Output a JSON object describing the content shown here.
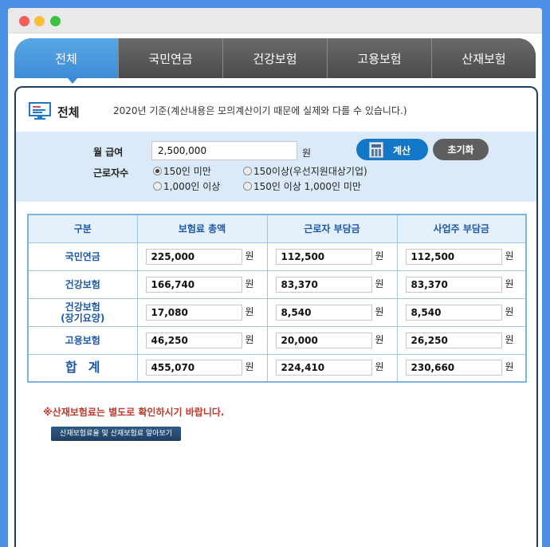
{
  "tabs": [
    {
      "label": "전체",
      "active": true
    },
    {
      "label": "국민연금",
      "active": false
    },
    {
      "label": "건강보험",
      "active": false
    },
    {
      "label": "고용보험",
      "active": false
    },
    {
      "label": "산재보험",
      "active": false
    }
  ],
  "header": {
    "title": "전체",
    "note": "2020년 기준(계산내용은 모의계산이기 때문에 실제와 다를 수 있습니다.)",
    "icon": "monitor-icon"
  },
  "form": {
    "salary_label": "월 급여",
    "salary_value": "2,500,000",
    "salary_unit": "원",
    "workers_label": "근로자수",
    "options": [
      {
        "label": "150인 미만",
        "selected": true
      },
      {
        "label": "150이상(우선지원대상기업)",
        "selected": false
      },
      {
        "label": "1,000인 이상",
        "selected": false
      },
      {
        "label": "150인 이상 1,000인 미만",
        "selected": false
      }
    ],
    "calc_button": "계산",
    "reset_button": "초기화"
  },
  "table": {
    "headers": [
      "구분",
      "보험료 총액",
      "근로자 부담금",
      "사업주 부담금"
    ],
    "unit": "원",
    "rows": [
      {
        "name": "국민연금",
        "total": "225,000",
        "employee": "112,500",
        "employer": "112,500"
      },
      {
        "name": "건강보험",
        "total": "166,740",
        "employee": "83,370",
        "employer": "83,370"
      },
      {
        "name": "건강보험",
        "name2": "(장기요양)",
        "total": "17,080",
        "employee": "8,540",
        "employer": "8,540"
      },
      {
        "name": "고용보험",
        "total": "46,250",
        "employee": "20,000",
        "employer": "26,250"
      },
      {
        "name": "합계",
        "total": "455,070",
        "employee": "224,410",
        "employer": "230,660"
      }
    ]
  },
  "notice": "※산재보험료는 별도로 확인하시기 바랍니다.",
  "link_button": "산재보험료율 및 산재보험료 알아보기",
  "colors": {
    "active_tab": "#3d8bd6",
    "notice": "#c0392b",
    "calc_button": "#1478c8",
    "reset_button": "#5e5e5e"
  }
}
